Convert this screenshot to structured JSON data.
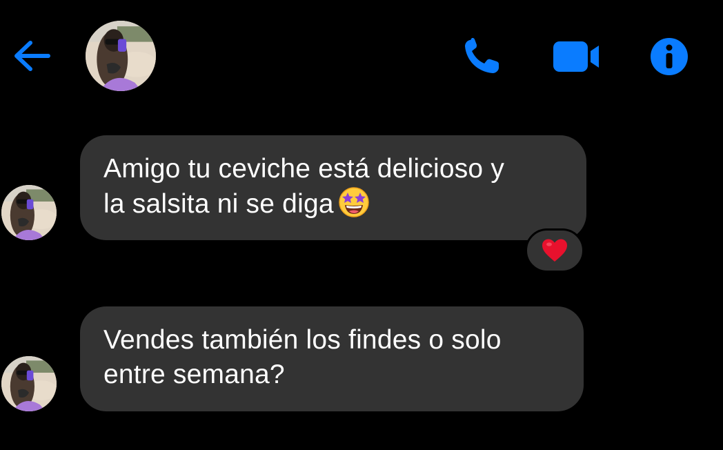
{
  "header": {
    "back_icon": "arrow-left-icon",
    "avatar_icon": "contact-avatar",
    "call_icon": "phone-icon",
    "video_icon": "video-camera-icon",
    "info_icon": "info-icon",
    "accent_color": "#0a7cff"
  },
  "messages": [
    {
      "text": "Amigo tu ceviche está delicioso y\nla salsita ni se diga",
      "emoji": "star-struck-emoji",
      "reaction": "heart-emoji"
    },
    {
      "text": "Vendes también los findes o solo\nentre semana?"
    }
  ],
  "colors": {
    "background": "#000000",
    "bubble": "#333333",
    "text": "#ffffff",
    "reaction_heart": "#e8112d"
  }
}
